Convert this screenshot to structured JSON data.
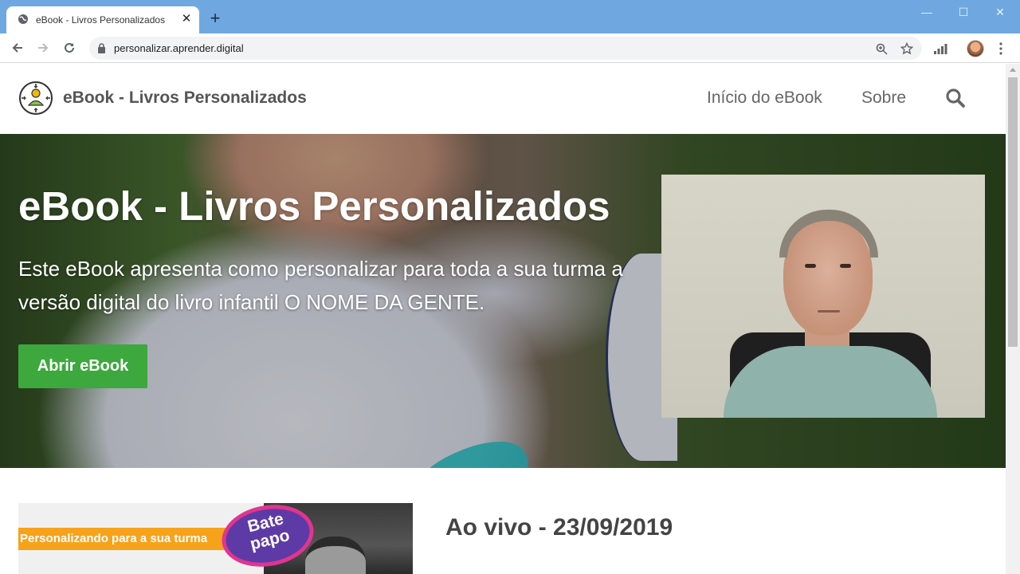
{
  "browser": {
    "tab_title": "eBook - Livros Personalizados",
    "tab_close": "✕",
    "new_tab": "+",
    "url": "personalizar.aprender.digital",
    "window_controls": {
      "minimize": "—",
      "maximize": "☐",
      "close": "✕"
    }
  },
  "site": {
    "title": "eBook - Livros Personalizados",
    "nav": [
      {
        "label": "Início do eBook"
      },
      {
        "label": "Sobre"
      }
    ]
  },
  "hero": {
    "title": "eBook - Livros Personalizados",
    "subtitle": "Este eBook apresenta como personalizar para toda a sua turma a versão digital do livro infantil O NOME DA GENTE.",
    "button_label": "Abrir eBook"
  },
  "section2": {
    "thumbnail_banner": "Personalizando para a sua turma",
    "thumbnail_bubble": "Bate\npapo",
    "heading": "Ao vivo - 23/09/2019"
  },
  "colors": {
    "chrome_tab_strip": "#6fa8e0",
    "primary_button": "#3da83d",
    "banner_orange": "#f7a21b",
    "bubble_purple": "#5e3aa6",
    "bubble_pink": "#e0358f"
  },
  "icons": [
    "globe-icon",
    "back-arrow-icon",
    "forward-arrow-icon",
    "reload-icon",
    "lock-icon",
    "zoom-icon",
    "star-icon",
    "signal-icon",
    "kebab-menu-icon",
    "site-logo-icon",
    "search-icon"
  ]
}
